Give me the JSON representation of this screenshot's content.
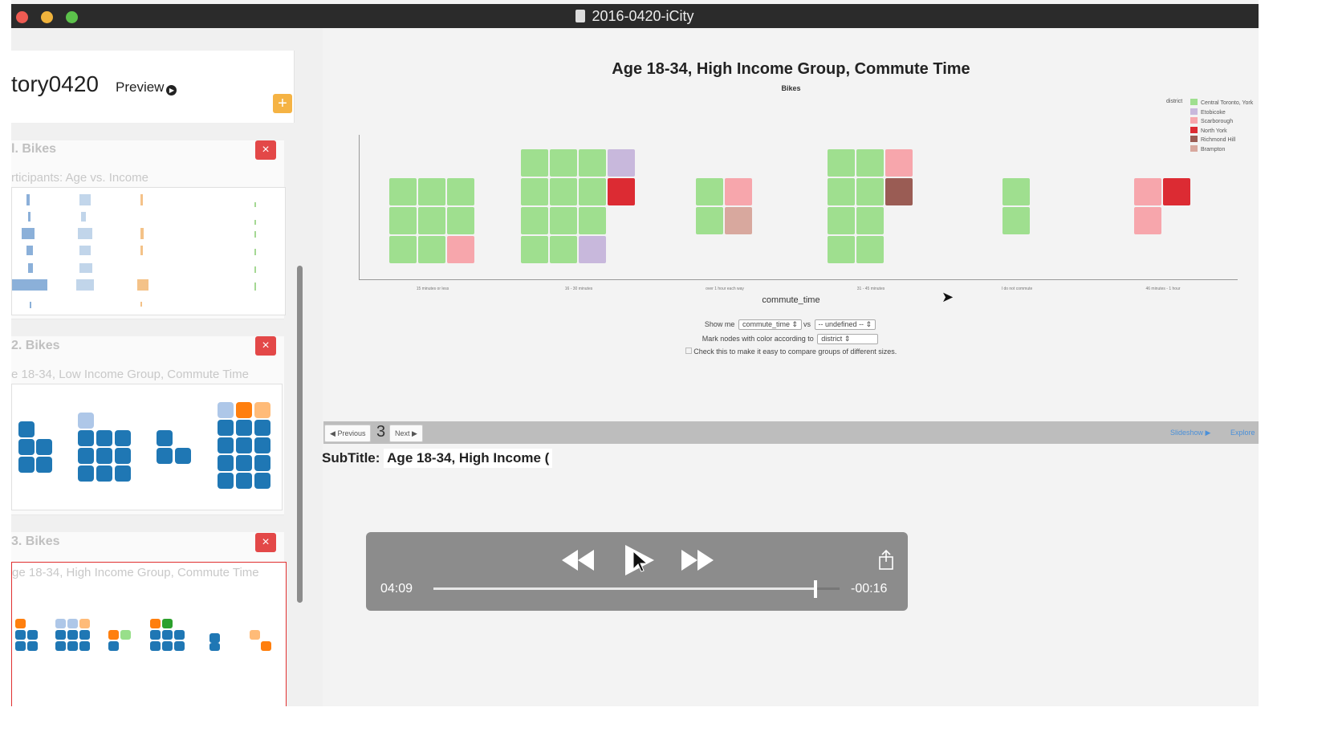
{
  "window": {
    "title": "2016-0420-iCity"
  },
  "sidebar": {
    "story_name": "tory0420",
    "preview_label": "Preview",
    "add_symbol": "+",
    "cards": [
      {
        "label": "l. Bikes",
        "subtitle": "rticipants: Age vs. Income"
      },
      {
        "label": "2. Bikes",
        "subtitle": "e 18-34, Low Income Group, Commute Time"
      },
      {
        "label": "3. Bikes",
        "subtitle": "ge 18-34, High Income Group, Commute Time"
      }
    ],
    "close_symbol": "×"
  },
  "chart": {
    "title": "Age 18-34, High Income Group, Commute Time",
    "subtitle": "Bikes",
    "xlabel": "commute_time",
    "legend_title": "district",
    "legend": [
      {
        "name": "Central Toronto, York",
        "color": "#9fdf8f"
      },
      {
        "name": "Etobicoke",
        "color": "#c8b8dc"
      },
      {
        "name": "Scarborough",
        "color": "#f7a6ac"
      },
      {
        "name": "North York",
        "color": "#dc2b33"
      },
      {
        "name": "Richmond Hill",
        "color": "#9a5c54"
      },
      {
        "name": "Brampton",
        "color": "#d8a89e"
      }
    ],
    "ticks": [
      "15 minutes or less",
      "16 - 30 minutes",
      "over 1 hour each way",
      "31 - 45 minutes",
      "I do not commute",
      "46 minutes - 1 hour"
    ],
    "controls": {
      "show_me": "Show me",
      "x_select": "commute_time",
      "vs": "vs",
      "y_select": "-- undefined --",
      "mark_nodes": "Mark nodes with color according to",
      "color_select": "district",
      "checkbox_label": "Check this to make it easy to compare groups of different sizes."
    }
  },
  "chart_data": {
    "type": "table",
    "title": "Age 18-34, High Income Group, Commute Time",
    "subtitle": "Bikes",
    "xlabel": "commute_time",
    "categories": [
      "15 minutes or less",
      "16 - 30 minutes",
      "over 1 hour each way",
      "31 - 45 minutes",
      "I do not commute",
      "46 minutes - 1 hour"
    ],
    "series": [
      {
        "name": "Central Toronto, York",
        "values": [
          8,
          11,
          2,
          8,
          2,
          0
        ]
      },
      {
        "name": "Etobicoke",
        "values": [
          0,
          2,
          0,
          0,
          0,
          0
        ]
      },
      {
        "name": "Scarborough",
        "values": [
          1,
          0,
          1,
          1,
          0,
          2
        ]
      },
      {
        "name": "North York",
        "values": [
          0,
          1,
          0,
          0,
          0,
          1
        ]
      },
      {
        "name": "Richmond Hill",
        "values": [
          0,
          0,
          0,
          1,
          0,
          0
        ]
      },
      {
        "name": "Brampton",
        "values": [
          0,
          0,
          1,
          0,
          0,
          0
        ]
      }
    ]
  },
  "nav": {
    "previous_label": "Previous",
    "page": "3",
    "next_label": "Next",
    "slideshow_label": "Slideshow",
    "explore_label": "Explore"
  },
  "subtitle_field": {
    "label": "SubTitle:",
    "value": "Age 18-34, High Income ("
  },
  "player": {
    "elapsed": "04:09",
    "remaining": "-00:16",
    "progress": 0.94
  }
}
